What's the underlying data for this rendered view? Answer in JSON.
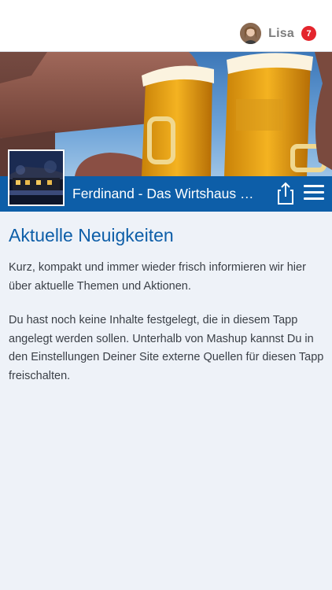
{
  "user": {
    "name": "Lisa",
    "notification_count": "7"
  },
  "site": {
    "title": "Ferdinand - Das Wirtshaus am Eck"
  },
  "main": {
    "heading": "Aktuelle Neuigkeiten",
    "intro": "Kurz, kompakt und immer wieder frisch informieren wir hier über aktuelle Themen und Aktionen.",
    "notice": "Du hast noch keine Inhalte festgelegt, die in diesem Tapp angelegt werden sollen. Unterhalb von Mashup kannst Du in den Einstellungen Deiner Site externe Quellen für diesen Tapp freischalten."
  },
  "icons": {
    "share": "share-icon",
    "menu": "hamburger-menu-icon"
  },
  "colors": {
    "brand_blue": "#0d5ea8",
    "badge_red": "#e4252d",
    "background": "#eef2f8"
  }
}
